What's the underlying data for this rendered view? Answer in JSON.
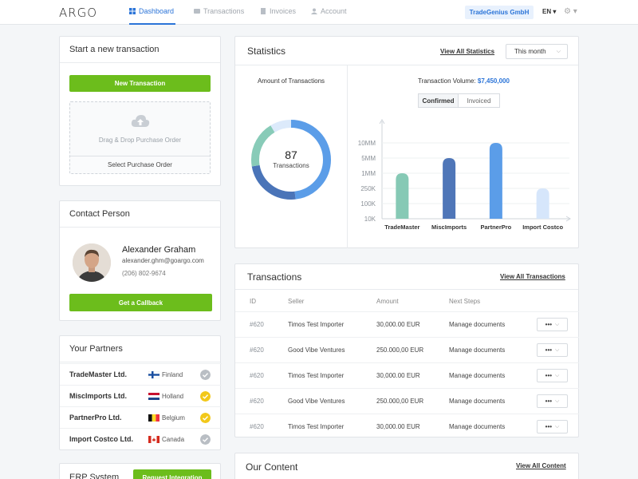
{
  "header": {
    "logo": "ARGO",
    "nav": [
      {
        "label": "Dashboard",
        "active": true
      },
      {
        "label": "Transactions",
        "active": false
      },
      {
        "label": "Invoices",
        "active": false
      },
      {
        "label": "Account",
        "active": false
      }
    ],
    "company": "TradeGenius GmbH",
    "lang": "EN ▾",
    "settings_icon": "gear-icon"
  },
  "new_transaction": {
    "title": "Start a new transaction",
    "button": "New Transaction",
    "drop_label": "Drag & Drop Purchase Order",
    "select_label": "Select Purchase Order"
  },
  "contact": {
    "title": "Contact Person",
    "name": "Alexander Graham",
    "email": "alexander.ghm@goargo.com",
    "phone": "(206) 802-9674",
    "button": "Get a Callback"
  },
  "partners": {
    "title": "Your Partners",
    "items": [
      {
        "name": "TradeMaster Ltd.",
        "country": "Finland",
        "verified": false
      },
      {
        "name": "MiscImports Ltd.",
        "country": "Holland",
        "verified": true
      },
      {
        "name": "PartnerPro Ltd.",
        "country": "Belgium",
        "verified": true
      },
      {
        "name": "Import Costco Ltd.",
        "country": "Canada",
        "verified": false
      }
    ]
  },
  "erp": {
    "title": "ERP System",
    "button": "Request Integration"
  },
  "statistics": {
    "title": "Statistics",
    "view_all": "View All Statistics",
    "period": "This month",
    "donut_title": "Amount of Transactions",
    "donut_value": "87",
    "donut_label": "Transactions",
    "volume_label": "Transaction Volume:",
    "volume_value": "$7,450,000",
    "toggle": [
      "Confirmed",
      "Invoiced"
    ],
    "colors": {
      "light_blue": "#5b9de8",
      "dark_blue": "#4a74b8",
      "teal": "#88cbb8",
      "pale": "#dceafb"
    }
  },
  "chart_data": {
    "type": "bar",
    "categories": [
      "TradeMaster",
      "MiscImports",
      "PartnerPro",
      "Import Costco"
    ],
    "y_ticks": [
      "10K",
      "100K",
      "250K",
      "1MM",
      "5MM",
      "10MM"
    ],
    "values": [
      1,
      5,
      10,
      0.25
    ],
    "ylabel": "",
    "colors": [
      "#86c9b5",
      "#4f76b8",
      "#5b9de8",
      "#d6e6fb"
    ]
  },
  "transactions": {
    "title": "Transactions",
    "view_all": "View All Transactions",
    "columns": [
      "ID",
      "Seller",
      "Amount",
      "Next Steps"
    ],
    "rows": [
      {
        "id": "#620",
        "seller": "Timos Test Importer",
        "amount": "30,000.00 EUR",
        "next": "Manage documents"
      },
      {
        "id": "#620",
        "seller": "Good Vibe Ventures",
        "amount": "250.000,00 EUR",
        "next": "Manage documents"
      },
      {
        "id": "#620",
        "seller": "Timos Test Importer",
        "amount": "30,000.00 EUR",
        "next": "Manage documents"
      },
      {
        "id": "#620",
        "seller": "Good Vibe Ventures",
        "amount": "250.000,00 EUR",
        "next": "Manage documents"
      },
      {
        "id": "#620",
        "seller": "Timos Test Importer",
        "amount": "30,000.00 EUR",
        "next": "Manage documents"
      }
    ],
    "action": "•••"
  },
  "content": {
    "title": "Our Content",
    "view_all": "View All Content"
  }
}
